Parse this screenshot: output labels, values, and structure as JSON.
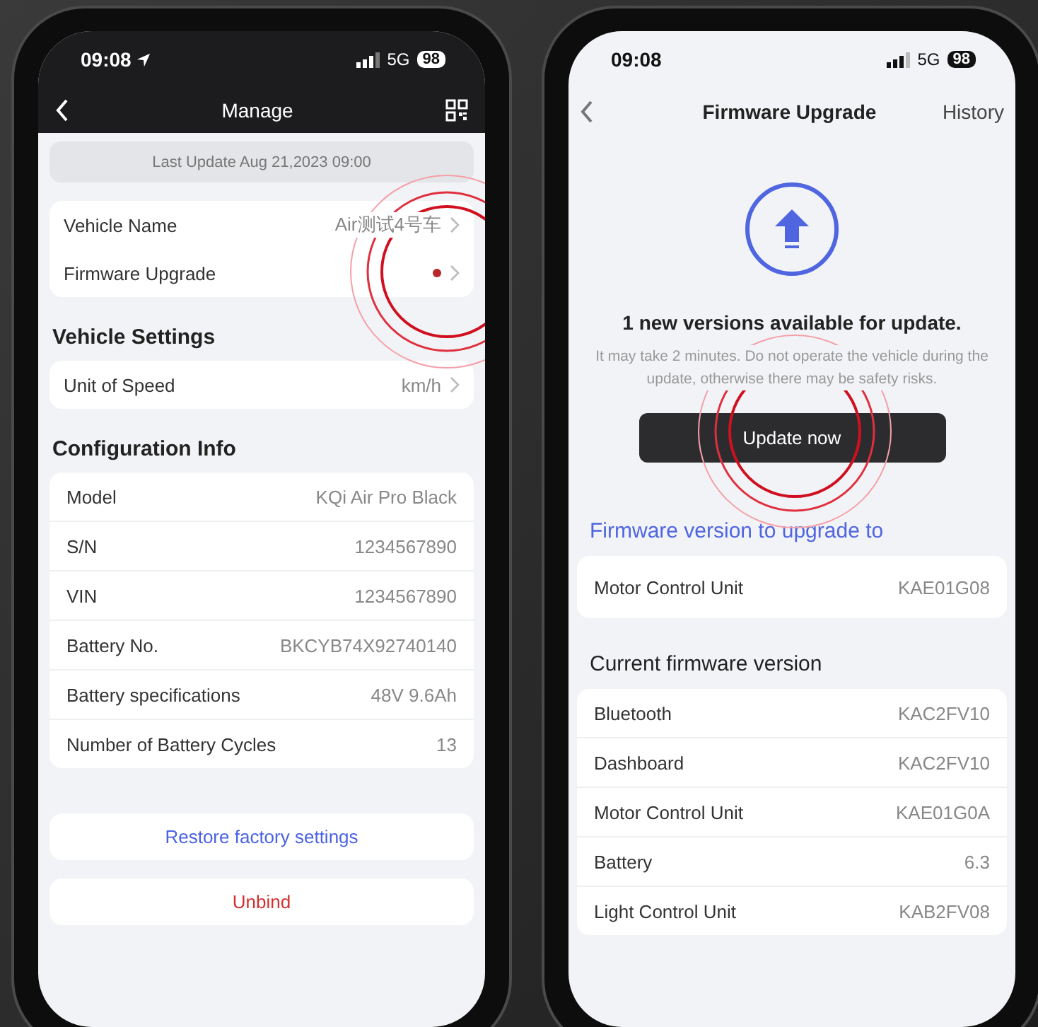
{
  "left_screen": {
    "status_bar": {
      "time": "09:08",
      "network": "5G",
      "battery": "98"
    },
    "header": {
      "title": "Manage"
    },
    "last_update": "Last Update Aug 21,2023 09:00",
    "general": [
      {
        "label": "Vehicle Name",
        "value": "Air测试4号车",
        "badge": false
      },
      {
        "label": "Firmware Upgrade",
        "badge": true
      }
    ],
    "vehicle_settings": {
      "title": "Vehicle Settings",
      "items": [
        {
          "label": "Unit of Speed",
          "value": "km/h"
        }
      ]
    },
    "configuration_info": {
      "title": "Configuration Info",
      "rows": [
        {
          "label": "Model",
          "value": "KQi Air Pro Black"
        },
        {
          "label": "S/N",
          "value": "1234567890"
        },
        {
          "label": "VIN",
          "value": "1234567890"
        },
        {
          "label": "Battery No.",
          "value": "BKCYB74X92740140"
        },
        {
          "label": "Battery specifications",
          "value": "48V 9.6Ah"
        },
        {
          "label": "Number of Battery Cycles",
          "value": "13"
        }
      ]
    },
    "actions": [
      {
        "label": "Restore factory settings",
        "kind": "primary"
      },
      {
        "label": "Unbind",
        "kind": "danger"
      }
    ]
  },
  "right_screen": {
    "status_bar": {
      "time": "09:08",
      "network": "5G",
      "battery": "98"
    },
    "header": {
      "title": "Firmware Upgrade",
      "action": "History"
    },
    "headline": "1 new versions available for update.",
    "description": "It may take 2 minutes. Do not operate the vehicle during the update, otherwise there may be safety risks.",
    "update_button": "Update now",
    "upgrade_section": {
      "title": "Firmware version to upgrade to",
      "rows": [
        {
          "label": "Motor Control Unit",
          "value": "KAE01G08"
        }
      ]
    },
    "current_section": {
      "title": "Current firmware version",
      "rows": [
        {
          "label": "Bluetooth",
          "value": "KAC2FV10"
        },
        {
          "label": "Dashboard",
          "value": "KAC2FV10"
        },
        {
          "label": "Motor Control Unit",
          "value": "KAE01G0A"
        },
        {
          "label": "Battery",
          "value": "6.3"
        },
        {
          "label": "Light Control Unit",
          "value": "KAB2FV08"
        }
      ]
    }
  }
}
